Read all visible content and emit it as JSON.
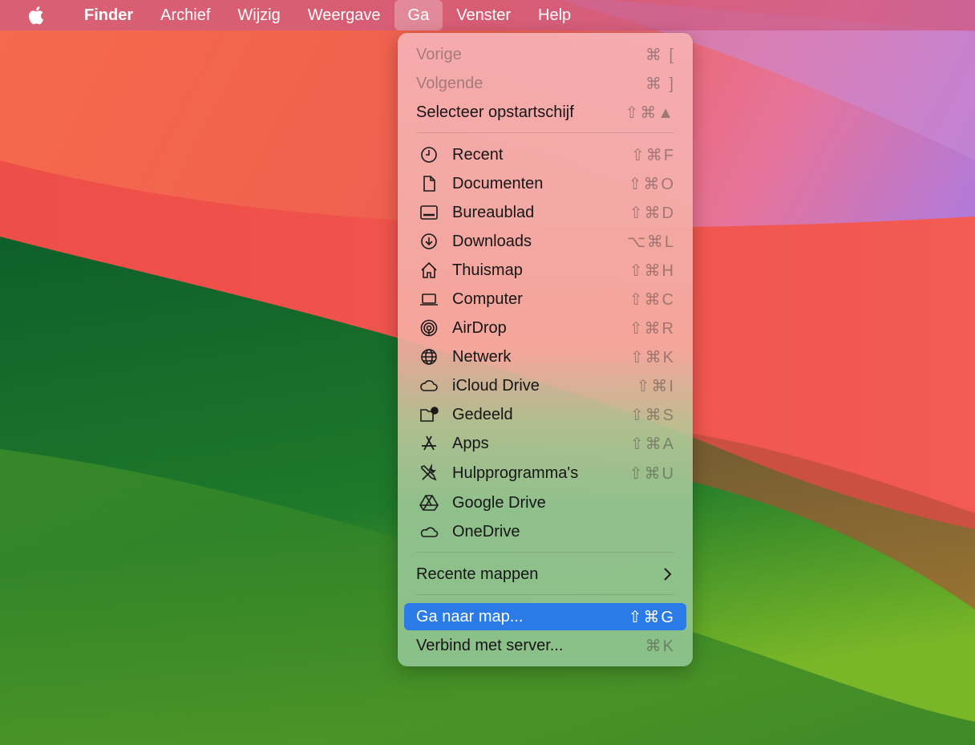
{
  "menubar": {
    "apple_icon": "apple-logo-icon",
    "items": [
      "Finder",
      "Archief",
      "Wijzig",
      "Weergave",
      "Ga",
      "Venster",
      "Help"
    ],
    "active": "Ga"
  },
  "menu": {
    "nav": [
      {
        "label": "Vorige",
        "shortcut": "⌘ [",
        "disabled": true
      },
      {
        "label": "Volgende",
        "shortcut": "⌘ ]",
        "disabled": true
      },
      {
        "label": "Selecteer opstartschijf",
        "shortcut": "⇧⌘▲",
        "disabled": false
      }
    ],
    "places": [
      {
        "label": "Recent",
        "shortcut": "⇧⌘F",
        "icon": "clock-icon"
      },
      {
        "label": "Documenten",
        "shortcut": "⇧⌘O",
        "icon": "document-icon"
      },
      {
        "label": "Bureaublad",
        "shortcut": "⇧⌘D",
        "icon": "desktop-icon"
      },
      {
        "label": "Downloads",
        "shortcut": "⌥⌘L",
        "icon": "download-icon"
      },
      {
        "label": "Thuismap",
        "shortcut": "⇧⌘H",
        "icon": "home-icon"
      },
      {
        "label": "Computer",
        "shortcut": "⇧⌘C",
        "icon": "laptop-icon"
      },
      {
        "label": "AirDrop",
        "shortcut": "⇧⌘R",
        "icon": "airdrop-icon"
      },
      {
        "label": "Netwerk",
        "shortcut": "⇧⌘K",
        "icon": "globe-icon"
      },
      {
        "label": "iCloud Drive",
        "shortcut": "⇧⌘I",
        "icon": "cloud-icon"
      },
      {
        "label": "Gedeeld",
        "shortcut": "⇧⌘S",
        "icon": "shared-folder-icon"
      },
      {
        "label": "Apps",
        "shortcut": "⇧⌘A",
        "icon": "apps-icon"
      },
      {
        "label": "Hulpprogramma's",
        "shortcut": "⇧⌘U",
        "icon": "tools-icon"
      },
      {
        "label": "Google Drive",
        "shortcut": "",
        "icon": "google-drive-icon"
      },
      {
        "label": "OneDrive",
        "shortcut": "",
        "icon": "cloud-icon"
      }
    ],
    "recent_folders": {
      "label": "Recente mappen"
    },
    "bottom": [
      {
        "label": "Ga naar map...",
        "shortcut": "⇧⌘G",
        "highlighted": true
      },
      {
        "label": "Verbind met server...",
        "shortcut": "⌘K",
        "highlighted": false
      }
    ]
  },
  "colors": {
    "highlight": "#2a7ae8",
    "wallpaper_red": "#f0554e",
    "wallpaper_green": "#0d6a2c"
  }
}
